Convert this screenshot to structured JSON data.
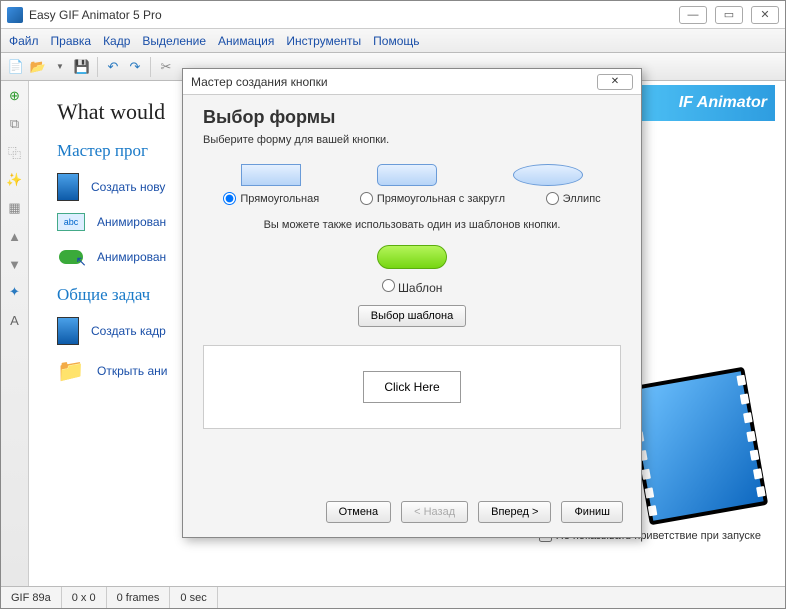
{
  "window": {
    "title": "Easy GIF Animator 5 Pro"
  },
  "menu": [
    "Файл",
    "Правка",
    "Кадр",
    "Выделение",
    "Анимация",
    "Инструменты",
    "Помощь"
  ],
  "content": {
    "heading": "What would",
    "section_wizards": "Мастер прог",
    "task_new": "Создать нову",
    "task_animtext": "Анимирован",
    "task_animbtn": "Анимирован",
    "section_common": "Общие задач",
    "task_frame": "Создать кадр",
    "task_open": "Открыть ани"
  },
  "banner": "IF Animator",
  "checkbox_label": "Не показывать приветствие при запуске",
  "statusbar": {
    "fmt": "GIF 89a",
    "dim": "0 x 0",
    "frames": "0 frames",
    "dur": "0 sec"
  },
  "dialog": {
    "title": "Мастер создания кнопки",
    "heading": "Выбор формы",
    "subtitle": "Выберите форму для вашей кнопки.",
    "radio_rect": "Прямоугольная",
    "radio_round": "Прямоугольная с закругл",
    "radio_ellipse": "Эллипс",
    "note": "Вы можете также использовать один из шаблонов кнопки.",
    "radio_template": "Шаблон",
    "btn_select_template": "Выбор шаблона",
    "preview_label": "Click Here",
    "btn_cancel": "Отмена",
    "btn_back": "< Назад",
    "btn_next": "Вперед >",
    "btn_finish": "Финиш"
  }
}
